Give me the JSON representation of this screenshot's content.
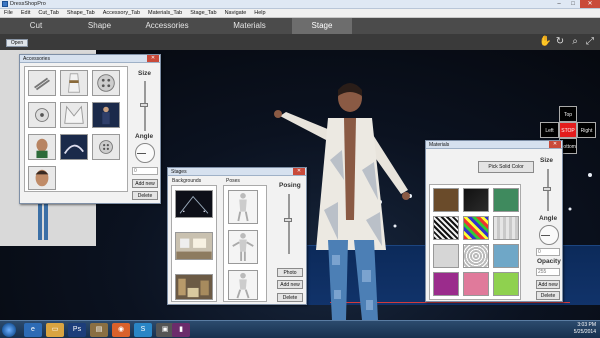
{
  "window": {
    "title": "DressShopPro"
  },
  "menu": [
    "File",
    "Edit",
    "Cut_Tab",
    "Shape_Tab",
    "Accessory_Tab",
    "Materials_Tab",
    "Stage_Tab",
    "Navigate",
    "Help"
  ],
  "tabs": [
    "Cut",
    "Shape",
    "Accessories",
    "Materials",
    "Stage"
  ],
  "active_tab": "Stage",
  "toolbar": {
    "open_label": "Open"
  },
  "direction_pad": {
    "top": "Top",
    "left": "Left",
    "stop": "STOP",
    "right": "Right",
    "bottom": "Bottom"
  },
  "accessories_window": {
    "title": "Accessories",
    "size_label": "Size",
    "angle_label": "Angle",
    "angle_value": "0",
    "add_new_label": "Add new",
    "delete_label": "Delete"
  },
  "stages_window": {
    "title": "Stages",
    "backgrounds_label": "Backgrounds",
    "poses_label": "Poses",
    "posing_label": "Posing",
    "photo_label": "Photo",
    "add_new_label": "Add new",
    "delete_label": "Delete"
  },
  "materials_window": {
    "title": "Materials",
    "pick_solid_color_label": "Pick Solid Color",
    "size_label": "Size",
    "angle_label": "Angle",
    "angle_value": "0",
    "opacity_label": "Opacity",
    "opacity_value": "255",
    "add_new_label": "Add new",
    "delete_label": "Delete"
  },
  "taskbar": {
    "time": "3:03 PM",
    "date": "5/25/2014"
  },
  "colors": {
    "stop_red": "#e31d1d",
    "tab_bg": "#4b4b4b",
    "active_tab_bg": "#6d6d6d",
    "runway_line": "#d23b3b"
  }
}
